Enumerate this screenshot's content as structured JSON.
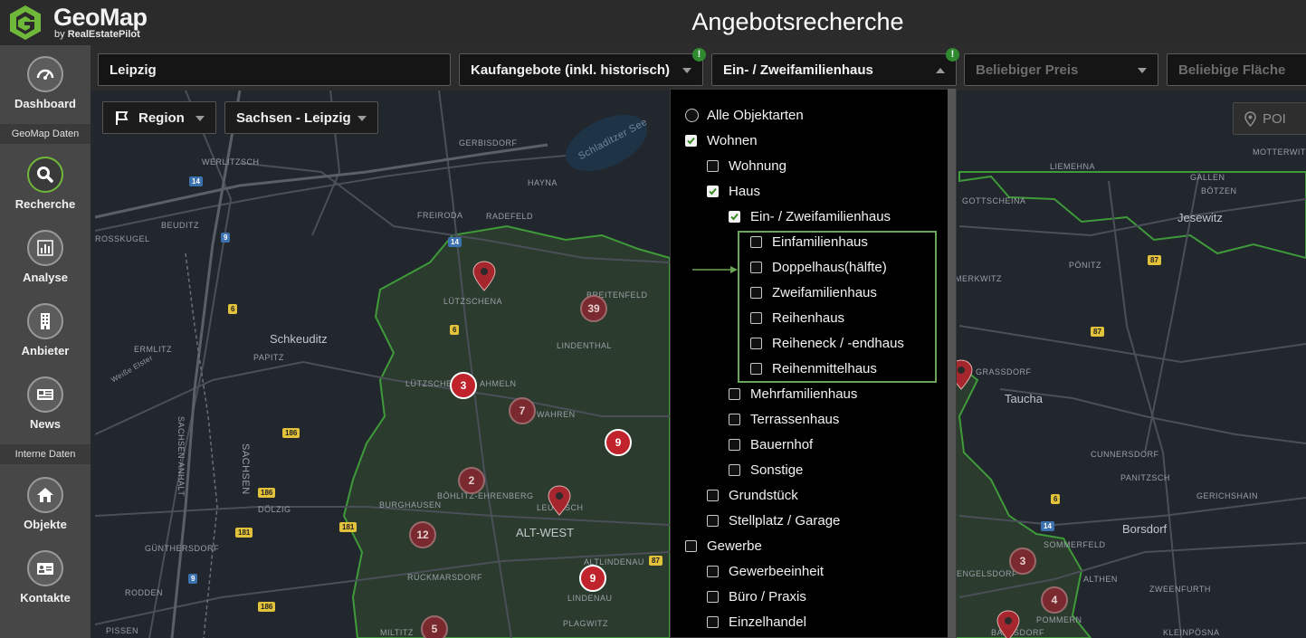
{
  "app": {
    "brand": "GeoMap",
    "byline_prefix": "by",
    "byline_company": "RealEstatePilot",
    "page_title": "Angebotsrecherche",
    "accent_color": "#6fb83a",
    "cluster_color": "#c0232b",
    "region_border_color": "#3f9b3a"
  },
  "sidebar": {
    "items": [
      {
        "label": "Dashboard",
        "icon": "speedometer-icon"
      },
      {
        "label": "Recherche",
        "icon": "search-icon",
        "active": true
      },
      {
        "label": "Analyse",
        "icon": "bar-chart-icon"
      },
      {
        "label": "Anbieter",
        "icon": "building-icon"
      },
      {
        "label": "News",
        "icon": "newspaper-icon"
      },
      {
        "label": "Objekte",
        "icon": "home-icon"
      },
      {
        "label": "Kontakte",
        "icon": "contact-card-icon"
      }
    ],
    "section_geomap": "GeoMap Daten",
    "section_internal": "Interne Daten"
  },
  "filters": {
    "location": "Leipzig",
    "offer_type": "Kaufangebote (inkl. historisch)",
    "property_type": "Ein- / Zweifamilienhaus",
    "price_placeholder": "Beliebiger Preis",
    "area_placeholder": "Beliebige Fläche",
    "badge": "!"
  },
  "map_controls": {
    "region_button": "Region",
    "region_select": "Sachsen - Leipzig",
    "poi_button": "POI"
  },
  "map": {
    "places": [
      "WERLITZSCH",
      "GERBISDORF",
      "HAYNA",
      "BEUDITZ",
      "FREIRODA",
      "RADEFELD",
      "ROSSKUGEL",
      "LÜTZSCHENA",
      "BREITENFELD",
      "Schkeuditz",
      "LINDENTHAL",
      "ERMLITZ",
      "PAPITZ",
      "LÜTZSCHENA",
      "AHMELN",
      "WAHREN",
      "DÖLZIG",
      "BURGHAUSEN",
      "BÖHLITZ-EHRENBERG",
      "LEUTZSCH",
      "ALT-WEST",
      "GÜNTHERSDORF",
      "RÜCKMARSDORF",
      "LINDENAU",
      "ALTLINDENAU",
      "RODDEN",
      "PISSEN",
      "MILTITZ",
      "PLAGWITZ",
      "SACHSEN-ANHALT",
      "SACHSEN",
      "Schladitzer See",
      "Weiße Elster",
      "LIEMEHNA",
      "MOTTERWITZ",
      "GALLEN",
      "BÖTZEN",
      "GOTTSCHEINA",
      "Jesewitz",
      "PÖNITZ",
      "MERKWITZ",
      "GRASSDORF",
      "Taucha",
      "CUNNERSDORF",
      "PANITZSCH",
      "GERICHSHAIN",
      "Borsdorf",
      "SOMMERFELD",
      "ENGELSDORF",
      "ALTHEN",
      "ZWEENFURTH",
      "BAALSDORF",
      "POMMERN",
      "KLEINPÖSNA"
    ],
    "road_numbers": [
      "14",
      "9",
      "14",
      "6",
      "6",
      "186",
      "186",
      "181",
      "181",
      "9",
      "186",
      "87",
      "87",
      "87",
      "6",
      "14"
    ],
    "clusters": [
      "39",
      "3",
      "7",
      "9",
      "2",
      "12",
      "9",
      "5",
      "3",
      "4"
    ]
  },
  "dropdown": {
    "options": [
      {
        "label": "Alle Objektarten",
        "state": "radio",
        "level": 0
      },
      {
        "label": "Wohnen",
        "state": "checked",
        "level": 0
      },
      {
        "label": "Wohnung",
        "state": "unchecked",
        "level": 1
      },
      {
        "label": "Haus",
        "state": "checked",
        "level": 1
      },
      {
        "label": "Ein- / Zweifamilienhaus",
        "state": "checked",
        "level": 2
      },
      {
        "label": "Einfamilienhaus",
        "state": "unchecked",
        "level": 3
      },
      {
        "label": "Doppelhaus(hälfte)",
        "state": "unchecked",
        "level": 3
      },
      {
        "label": "Zweifamilienhaus",
        "state": "unchecked",
        "level": 3
      },
      {
        "label": "Reihenhaus",
        "state": "unchecked",
        "level": 3
      },
      {
        "label": "Reiheneck / -endhaus",
        "state": "unchecked",
        "level": 3
      },
      {
        "label": "Reihenmittelhaus",
        "state": "unchecked",
        "level": 3
      },
      {
        "label": "Mehrfamilienhaus",
        "state": "unchecked",
        "level": 2
      },
      {
        "label": "Terrassenhaus",
        "state": "unchecked",
        "level": 2
      },
      {
        "label": "Bauernhof",
        "state": "unchecked",
        "level": 2
      },
      {
        "label": "Sonstige",
        "state": "unchecked",
        "level": 2
      },
      {
        "label": "Grundstück",
        "state": "unchecked",
        "level": 1
      },
      {
        "label": "Stellplatz / Garage",
        "state": "unchecked",
        "level": 1
      },
      {
        "label": "Gewerbe",
        "state": "unchecked",
        "level": 0
      },
      {
        "label": "Gewerbeeinheit",
        "state": "unchecked",
        "level": 1
      },
      {
        "label": "Büro / Praxis",
        "state": "unchecked",
        "level": 1
      },
      {
        "label": "Einzelhandel",
        "state": "unchecked",
        "level": 1
      }
    ]
  }
}
